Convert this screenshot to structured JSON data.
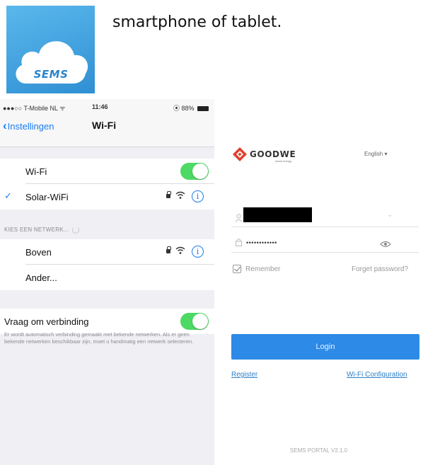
{
  "intro": {
    "app_icon_label": "SEMS",
    "text": "smartphone of tablet."
  },
  "ios_settings": {
    "status_bar": {
      "carrier": "●●●○○ T-Mobile NL ᯤ",
      "time": "11:46",
      "battery": "⦿ 88%"
    },
    "nav": {
      "back_label": "Instellingen",
      "title": "Wi-Fi"
    },
    "wifi_toggle": {
      "label": "Wi-Fi",
      "on": true
    },
    "connected_network": {
      "name": "Solar-WiFi",
      "checked": true
    },
    "section_header": "KIES EEN NETWERK...",
    "networks": [
      {
        "name": "Boven"
      },
      {
        "name": "Ander..."
      }
    ],
    "ask_to_join": {
      "label": "Vraag om verbinding",
      "on": true
    },
    "footer_note": "Er wordt automatisch verbinding gemaakt met bekende netwerken. Als er geen bekende netwerken beschikbaar zijn, moet u handmatig een netwerk selecteren.",
    "colors": {
      "toggle_on": "#4cd964",
      "ios_blue": "#1a7cf0"
    }
  },
  "sems_login": {
    "logo_text": "GOODWE",
    "logo_tagline": "smart energy",
    "language": "English ▾",
    "username_value": "",
    "password_value": "••••••••••••",
    "remember_label": "Remember",
    "forget_password": "Forget password?",
    "login_button": "Login",
    "register_link": "Register",
    "wifi_config_link": "Wi-Fi Configuration",
    "portal_version": "SEMS PORTAL V2.1.0",
    "colors": {
      "login_button": "#2d8ae6",
      "logo_red": "#e0402f"
    }
  }
}
